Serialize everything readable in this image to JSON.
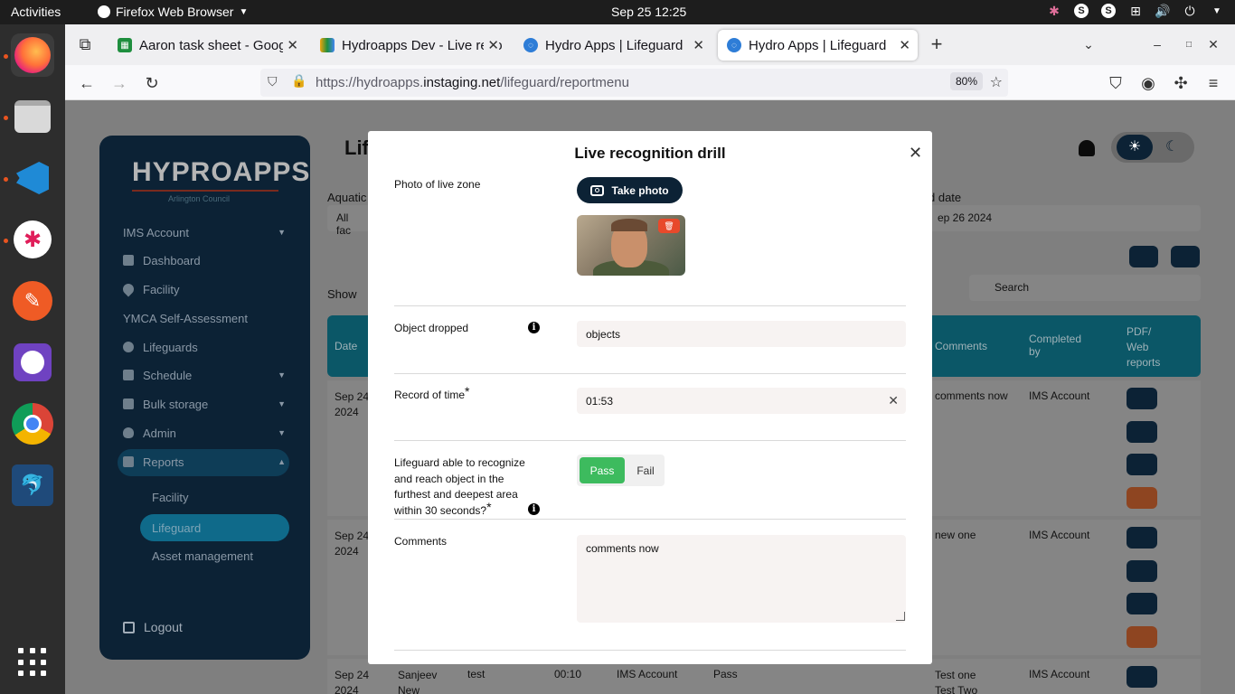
{
  "topbar": {
    "activities": "Activities",
    "app_name": "Firefox Web Browser",
    "clock": "Sep 25  12:25"
  },
  "dock": {
    "items": [
      "firefox-icon",
      "files-icon",
      "vscode-icon",
      "slack-icon",
      "postman-icon",
      "github-desktop-icon",
      "chrome-icon",
      "mysql-workbench-icon",
      "app-grid-icon"
    ]
  },
  "browser": {
    "tabs": [
      {
        "label": "Aaron task sheet - Google",
        "color": "#1e8e3e"
      },
      {
        "label": "Hydroapps Dev - Live reco",
        "color": "#f0a30a"
      },
      {
        "label": "Hydro Apps | Lifeguard",
        "color": "#2e7dd7"
      },
      {
        "label": "Hydro Apps | Lifeguard",
        "color": "#2e7dd7"
      }
    ],
    "url_prefix": "https://hydroapps.",
    "url_domain": "instaging.net",
    "url_path": "/lifeguard/reportmenu",
    "zoom": "80%"
  },
  "sidebar": {
    "logo": "HYPROAPPS",
    "subtitle": "Arlington Council",
    "items": [
      {
        "label": "IMS Account"
      },
      {
        "label": "Dashboard"
      },
      {
        "label": "Facility"
      },
      {
        "label": "YMCA Self-Assessment"
      },
      {
        "label": "Lifeguards"
      },
      {
        "label": "Schedule"
      },
      {
        "label": "Bulk storage"
      },
      {
        "label": "Admin"
      },
      {
        "label": "Reports"
      },
      {
        "label": "Facility"
      },
      {
        "label": "Lifeguard"
      },
      {
        "label": "Asset management"
      }
    ],
    "logout": "Logout"
  },
  "background": {
    "title": "Lif",
    "aquatic_label": "Aquatic",
    "aquatic_value": "All fac",
    "end_date_label": "d date",
    "end_date_value": "ep 26 2024",
    "show_label": "Show",
    "search_placeholder": "Search",
    "headers": {
      "date": "Date",
      "comments": "Comments",
      "completed_by": "Completed by",
      "pdf": "PDF/ Web reports"
    },
    "rows": [
      {
        "date": "Sep 24 2024",
        "comments": "comments now",
        "completed_by": "IMS Account"
      },
      {
        "date": "Sep 24 2024",
        "comments": "new one",
        "completed_by": "IMS Account"
      },
      {
        "date": "Sep 24 2024",
        "lifeguard": "Sanjeev New",
        "object": "test",
        "time": "00:10",
        "account": "IMS Account",
        "result": "Pass",
        "comments": "Test one Test Two",
        "completed_by": "IMS Account"
      }
    ]
  },
  "modal": {
    "title": "Live recognition drill",
    "photo_label": "Photo of live zone",
    "take_photo": "Take photo",
    "object_label": "Object dropped",
    "object_value": "objects",
    "time_label": "Record of time",
    "time_value": "01:53",
    "recognize_label": "Lifeguard able to recognize and reach object in the furthest and deepest area within 30 seconds?",
    "pass_label": "Pass",
    "fail_label": "Fail",
    "comments_label": "Comments",
    "comments_value": "comments now",
    "required_mark": "*"
  }
}
